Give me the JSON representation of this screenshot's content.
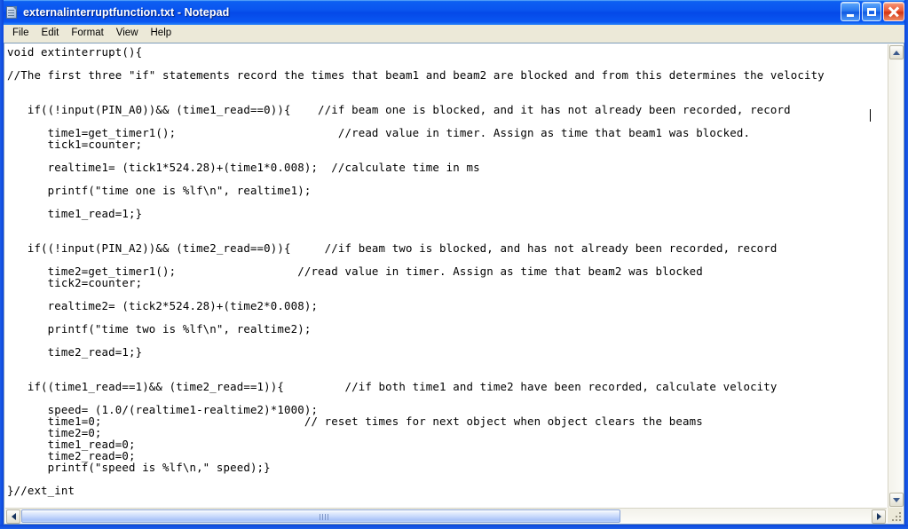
{
  "window": {
    "title": "externalinterruptfunction.txt - Notepad",
    "app_icon": "notepad-document-icon",
    "buttons": {
      "minimize": "Minimize",
      "maximize": "Maximize",
      "close": "Close"
    }
  },
  "menubar": {
    "items": [
      {
        "label": "File"
      },
      {
        "label": "Edit"
      },
      {
        "label": "Format"
      },
      {
        "label": "View"
      },
      {
        "label": "Help"
      }
    ]
  },
  "document": {
    "filename": "externalinterruptfunction.txt",
    "lines": [
      "void extinterrupt(){",
      "",
      "//The first three \"if\" statements record the times that beam1 and beam2 are blocked and from this determines the velocity",
      "",
      "",
      "   if((!input(PIN_A0))&& (time1_read==0)){    //if beam one is blocked, and it has not already been recorded, record",
      "",
      "      time1=get_timer1();                        //read value in timer. Assign as time that beam1 was blocked.",
      "      tick1=counter;",
      "",
      "      realtime1= (tick1*524.28)+(time1*0.008);  //calculate time in ms",
      "",
      "      printf(\"time one is %lf\\n\", realtime1);",
      "",
      "      time1_read=1;}",
      "",
      "",
      "   if((!input(PIN_A2))&& (time2_read==0)){     //if beam two is blocked, and has not already been recorded, record",
      "",
      "      time2=get_timer1();                  //read value in timer. Assign as time that beam2 was blocked",
      "      tick2=counter;",
      "",
      "      realtime2= (tick2*524.28)+(time2*0.008);",
      "",
      "      printf(\"time two is %lf\\n\", realtime2);",
      "",
      "      time2_read=1;}",
      "",
      "",
      "   if((time1_read==1)&& (time2_read==1)){         //if both time1 and time2 have been recorded, calculate velocity",
      "",
      "      speed= (1.0/(realtime1-realtime2)*1000);",
      "      time1=0;                              // reset times for next object when object clears the beams",
      "      time2=0;",
      "      time1_read=0;",
      "      time2_read=0;",
      "      printf(\"speed is %lf\\n,\" speed);}",
      "",
      "}//ext_int"
    ]
  },
  "scrollbars": {
    "vertical": {
      "up_arrow": "scroll-up-arrow",
      "down_arrow": "scroll-down-arrow"
    },
    "horizontal": {
      "left_arrow": "scroll-left-arrow",
      "right_arrow": "scroll-right-arrow",
      "thumb": "horizontal-scroll-thumb"
    }
  },
  "colors": {
    "titlebar_blue": "#0a55ef",
    "menubar_bg": "#ece9d8",
    "client_bg": "#ffffff",
    "close_button_red": "#d43412",
    "scroll_thumb_blue": "#a8c2f8"
  }
}
